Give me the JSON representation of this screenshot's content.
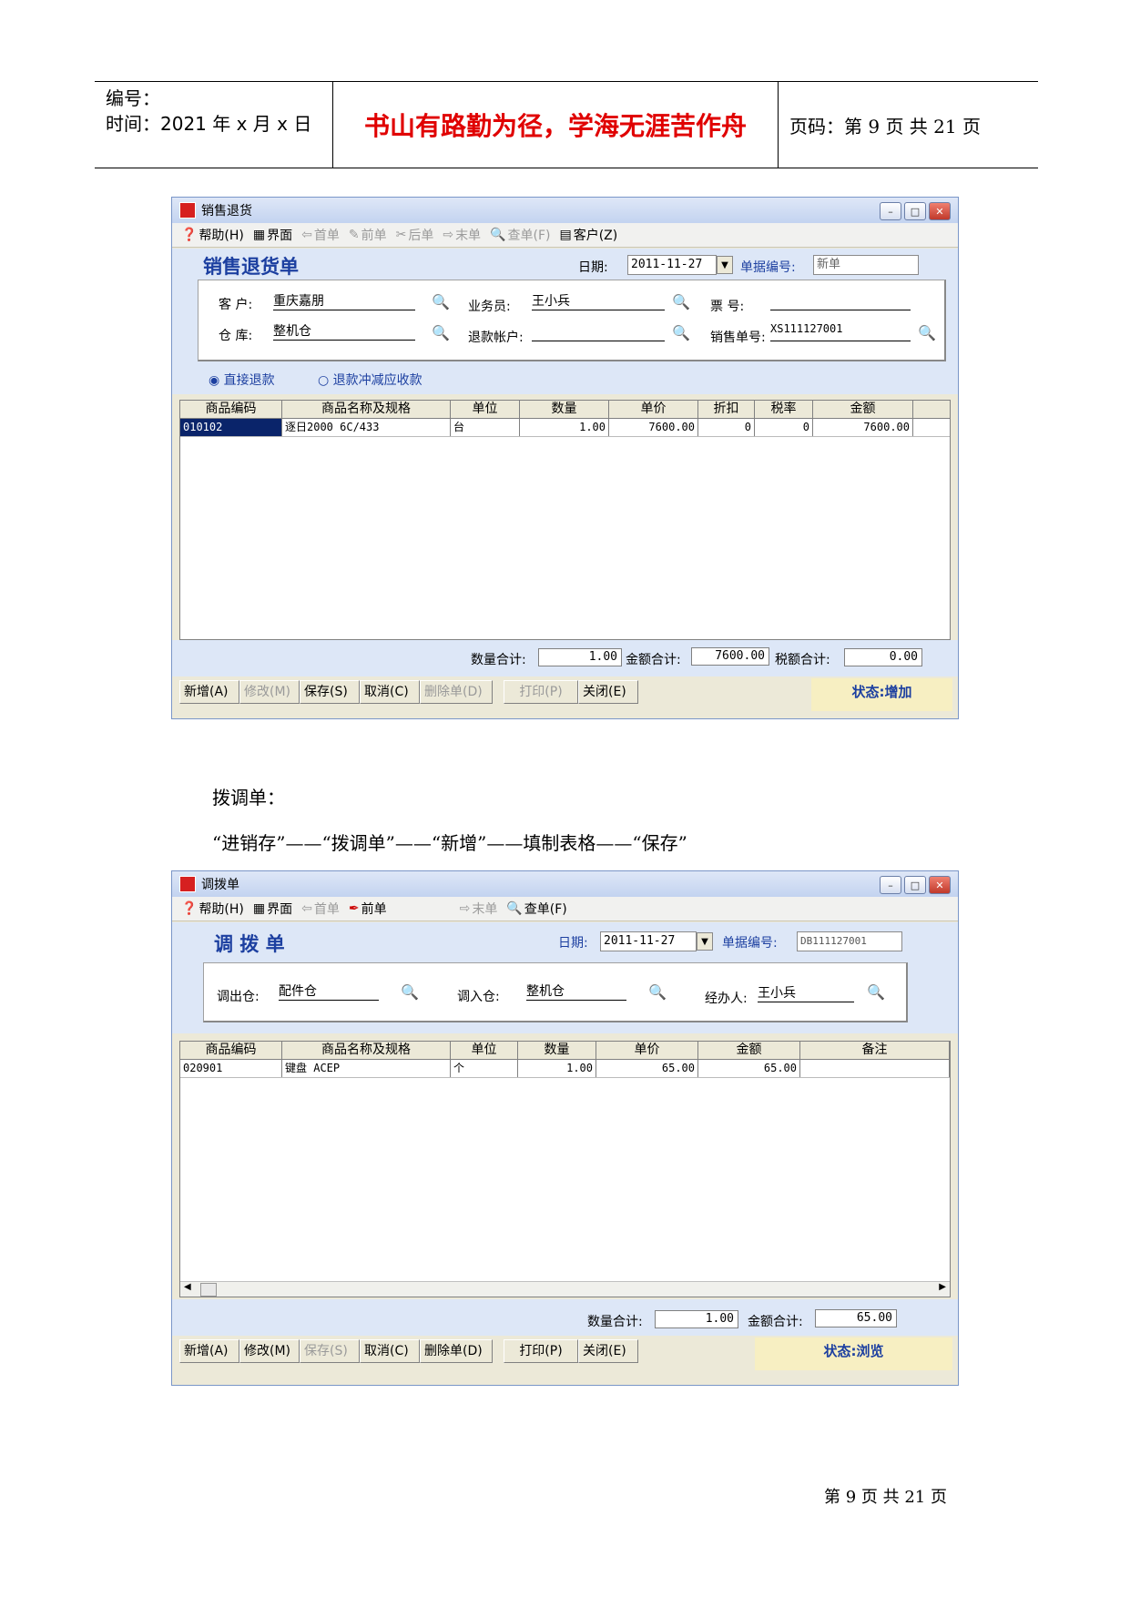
{
  "header": {
    "number_label": "编号：",
    "time_label": "时间：2021 年 x 月 x 日",
    "motto": "书山有路勤为径，学海无涯苦作舟",
    "page_label": "页码：第 9 页  共 21 页"
  },
  "win1": {
    "title": "销售退货",
    "toolbar": [
      {
        "label": "帮助(H)",
        "icon": "help-icon",
        "enabled": true
      },
      {
        "label": "界面",
        "icon": "layout-icon",
        "enabled": true
      },
      {
        "label": "首单",
        "icon": "first-icon",
        "enabled": false
      },
      {
        "label": "前单",
        "icon": "prev-icon",
        "enabled": false
      },
      {
        "label": "后单",
        "icon": "next-icon",
        "enabled": false
      },
      {
        "label": "末单",
        "icon": "last-icon",
        "enabled": false
      },
      {
        "label": "查单(F)",
        "icon": "search-doc-icon",
        "enabled": false
      },
      {
        "label": "客户(Z)",
        "icon": "customer-icon",
        "enabled": true
      }
    ],
    "form_title": "销售退货单",
    "date_label": "日期:",
    "date_value": "2011-11-27",
    "doc_no_label": "单据编号:",
    "doc_no_value": "新单",
    "customer_label": "客  户:",
    "customer_value": "重庆嘉朋",
    "salesman_label": "业务员:",
    "salesman_value": "王小兵",
    "ticket_label": "票  号:",
    "ticket_value": "",
    "warehouse_label": "仓  库:",
    "warehouse_value": "整机仓",
    "refund_account_label": "退款帐户:",
    "refund_account_value": "",
    "sales_no_label": "销售单号:",
    "sales_no_value": "XS111127001",
    "radio1": "直接退款",
    "radio2": "退款冲减应收款",
    "columns": [
      "商品编码",
      "商品名称及规格",
      "单位",
      "数量",
      "单价",
      "折扣",
      "税率",
      "金额"
    ],
    "rows": [
      [
        "010102",
        "逐日2000 6C/433",
        "台",
        "1.00",
        "7600.00",
        "0",
        "0",
        "7600.00"
      ]
    ],
    "qty_total_label": "数量合计:",
    "qty_total": "1.00",
    "amount_total_label": "金额合计:",
    "amount_total": "7600.00",
    "tax_total_label": "税额合计:",
    "tax_total": "0.00",
    "buttons": [
      {
        "label": "新增(A)",
        "enabled": true
      },
      {
        "label": "修改(M)",
        "enabled": false
      },
      {
        "label": "保存(S)",
        "enabled": true
      },
      {
        "label": "取消(C)",
        "enabled": true
      },
      {
        "label": "删除单(D)",
        "enabled": false
      },
      {
        "label": "打印(P)",
        "enabled": false
      },
      {
        "label": "关闭(E)",
        "enabled": true
      }
    ],
    "status": "状态:增加"
  },
  "text": {
    "line1": "拨调单：",
    "line2": "“进销存”——“拨调单”——“新增”——填制表格——“保存”"
  },
  "win2": {
    "title": "调拨单",
    "toolbar": [
      {
        "label": "帮助(H)",
        "icon": "help-icon",
        "enabled": true
      },
      {
        "label": "界面",
        "icon": "layout-icon",
        "enabled": true
      },
      {
        "label": "首单",
        "icon": "first-icon",
        "enabled": false
      },
      {
        "label": "前单",
        "icon": "prev-icon",
        "enabled": true
      },
      {
        "label": "末单",
        "icon": "last-icon",
        "enabled": false
      },
      {
        "label": "查单(F)",
        "icon": "search-doc-icon",
        "enabled": true
      }
    ],
    "form_title": "调 拨 单",
    "date_label": "日期:",
    "date_value": "2011-11-27",
    "doc_no_label": "单据编号:",
    "doc_no_value": "DB111127001",
    "out_label": "调出仓:",
    "out_value": "配件仓",
    "in_label": "调入仓:",
    "in_value": "整机仓",
    "handler_label": "经办人:",
    "handler_value": "王小兵",
    "columns": [
      "商品编码",
      "商品名称及规格",
      "单位",
      "数量",
      "单价",
      "金额",
      "备注"
    ],
    "rows": [
      [
        "020901",
        "键盘 ACEP",
        "个",
        "1.00",
        "65.00",
        "65.00",
        ""
      ]
    ],
    "qty_total_label": "数量合计:",
    "qty_total": "1.00",
    "amount_total_label": "金额合计:",
    "amount_total": "65.00",
    "buttons": [
      {
        "label": "新增(A)",
        "enabled": true
      },
      {
        "label": "修改(M)",
        "enabled": true
      },
      {
        "label": "保存(S)",
        "enabled": false
      },
      {
        "label": "取消(C)",
        "enabled": true
      },
      {
        "label": "删除单(D)",
        "enabled": true
      },
      {
        "label": "打印(P)",
        "enabled": true
      },
      {
        "label": "关闭(E)",
        "enabled": true
      }
    ],
    "status": "状态:浏览"
  },
  "footer": "第 9 页 共 21 页"
}
